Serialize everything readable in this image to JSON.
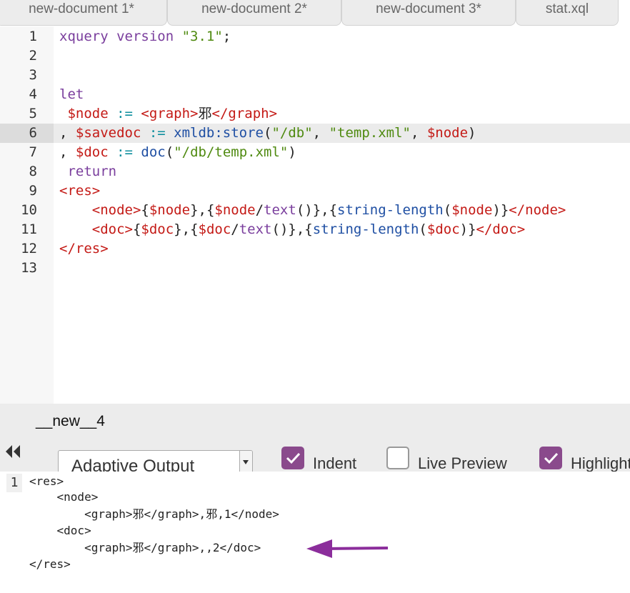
{
  "tabs": [
    {
      "label": "new-document 1*"
    },
    {
      "label": "new-document 2*"
    },
    {
      "label": "new-document 3*"
    },
    {
      "label": "stat.xql"
    }
  ],
  "editor": {
    "active_line": 6,
    "lines": [
      {
        "n": "1",
        "segs": [
          [
            "kw",
            "xquery version "
          ],
          [
            "str",
            "\"3.1\""
          ],
          [
            "pl",
            ";"
          ]
        ]
      },
      {
        "n": "2",
        "segs": []
      },
      {
        "n": "3",
        "segs": []
      },
      {
        "n": "4",
        "segs": [
          [
            "kw",
            "let"
          ]
        ]
      },
      {
        "n": "5",
        "segs": [
          [
            "pl",
            " "
          ],
          [
            "var",
            "$node"
          ],
          [
            "op",
            " := "
          ],
          [
            "tag",
            "<graph>"
          ],
          [
            "pl",
            "邪"
          ],
          [
            "tag",
            "</graph>"
          ]
        ]
      },
      {
        "n": "6",
        "segs": [
          [
            "pl",
            ", "
          ],
          [
            "var",
            "$savedoc"
          ],
          [
            "op",
            " := "
          ],
          [
            "fn",
            "xmldb:store"
          ],
          [
            "pl",
            "("
          ],
          [
            "str",
            "\"/db\""
          ],
          [
            "pl",
            ", "
          ],
          [
            "str",
            "\"temp.xml\""
          ],
          [
            "pl",
            ", "
          ],
          [
            "var",
            "$node"
          ],
          [
            "pl",
            ")"
          ]
        ]
      },
      {
        "n": "7",
        "segs": [
          [
            "pl",
            ", "
          ],
          [
            "var",
            "$doc"
          ],
          [
            "op",
            " := "
          ],
          [
            "fn",
            "doc"
          ],
          [
            "pl",
            "("
          ],
          [
            "str",
            "\"/db/temp.xml\""
          ],
          [
            "pl",
            ")"
          ]
        ]
      },
      {
        "n": "8",
        "segs": [
          [
            "pl",
            " "
          ],
          [
            "kw",
            "return"
          ]
        ]
      },
      {
        "n": "9",
        "segs": [
          [
            "tag",
            "<res>"
          ]
        ]
      },
      {
        "n": "10",
        "segs": [
          [
            "pl",
            "    "
          ],
          [
            "tag",
            "<node>"
          ],
          [
            "pl",
            "{"
          ],
          [
            "var",
            "$node"
          ],
          [
            "pl",
            "},{"
          ],
          [
            "var",
            "$node"
          ],
          [
            "pl",
            "/"
          ],
          [
            "kw",
            "text"
          ],
          [
            "pl",
            "()},{"
          ],
          [
            "fn",
            "string-length"
          ],
          [
            "pl",
            "("
          ],
          [
            "var",
            "$node"
          ],
          [
            "pl",
            ")}"
          ],
          [
            "tag",
            "</node>"
          ]
        ]
      },
      {
        "n": "11",
        "segs": [
          [
            "pl",
            "    "
          ],
          [
            "tag",
            "<doc>"
          ],
          [
            "pl",
            "{"
          ],
          [
            "var",
            "$doc"
          ],
          [
            "pl",
            "},{"
          ],
          [
            "var",
            "$doc"
          ],
          [
            "pl",
            "/"
          ],
          [
            "kw",
            "text"
          ],
          [
            "pl",
            "()},{"
          ],
          [
            "fn",
            "string-length"
          ],
          [
            "pl",
            "("
          ],
          [
            "var",
            "$doc"
          ],
          [
            "pl",
            ")}"
          ],
          [
            "tag",
            "</doc>"
          ]
        ]
      },
      {
        "n": "12",
        "segs": [
          [
            "tag",
            "</res>"
          ]
        ]
      },
      {
        "n": "13",
        "segs": []
      }
    ]
  },
  "output": {
    "title": "__new__4",
    "mode": "Adaptive Output",
    "options": [
      {
        "label": "Indent",
        "checked": true
      },
      {
        "label": "Live Preview",
        "checked": false
      },
      {
        "label": "Highlight",
        "checked": true
      }
    ]
  },
  "result": {
    "gutter_number": "1",
    "lines": [
      "<res>",
      "    <node>",
      "        <graph>邪</graph>,邪,1</node>",
      "    <doc>",
      "        <graph>邪</graph>,,2</doc>",
      "</res>"
    ]
  },
  "colors": {
    "accent_checkbox": "#8a4a8c",
    "arrow": "#8b2d9b"
  },
  "icons": {
    "collapse": "double-chevron-left-icon",
    "dropdown": "chevron-down-icon",
    "arrow": "arrow-left-icon"
  }
}
